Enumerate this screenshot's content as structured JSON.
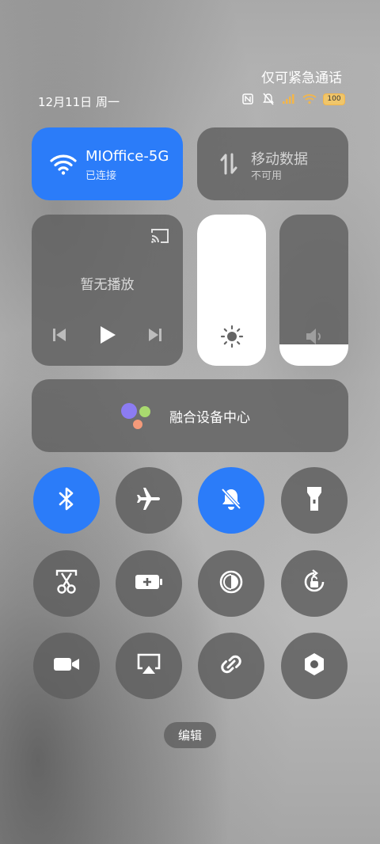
{
  "status": {
    "emergency_text": "仅可紧急通话",
    "date": "12月11日 周一",
    "battery": "100"
  },
  "wifi": {
    "name": "MIOffice-5G",
    "status": "已连接"
  },
  "mobile": {
    "title": "移动数据",
    "status": "不可用"
  },
  "media": {
    "label": "暂无播放"
  },
  "brightness": {
    "level_percent": 100
  },
  "volume": {
    "level_percent": 14
  },
  "hub": {
    "label": "融合设备中心"
  },
  "toggles": [
    {
      "name": "bluetooth",
      "on": true
    },
    {
      "name": "airplane",
      "on": false
    },
    {
      "name": "mute",
      "on": true
    },
    {
      "name": "flashlight",
      "on": false
    },
    {
      "name": "screenshot",
      "on": false
    },
    {
      "name": "battery-saver",
      "on": false
    },
    {
      "name": "dark-mode",
      "on": false
    },
    {
      "name": "rotation-lock",
      "on": false
    },
    {
      "name": "video-call",
      "on": false
    },
    {
      "name": "screen-cast",
      "on": false
    },
    {
      "name": "link",
      "on": false
    },
    {
      "name": "settings",
      "on": false
    }
  ],
  "edit": {
    "label": "编辑"
  },
  "colors": {
    "accent": "#2b7cf9",
    "tile": "#5f5f5f"
  }
}
